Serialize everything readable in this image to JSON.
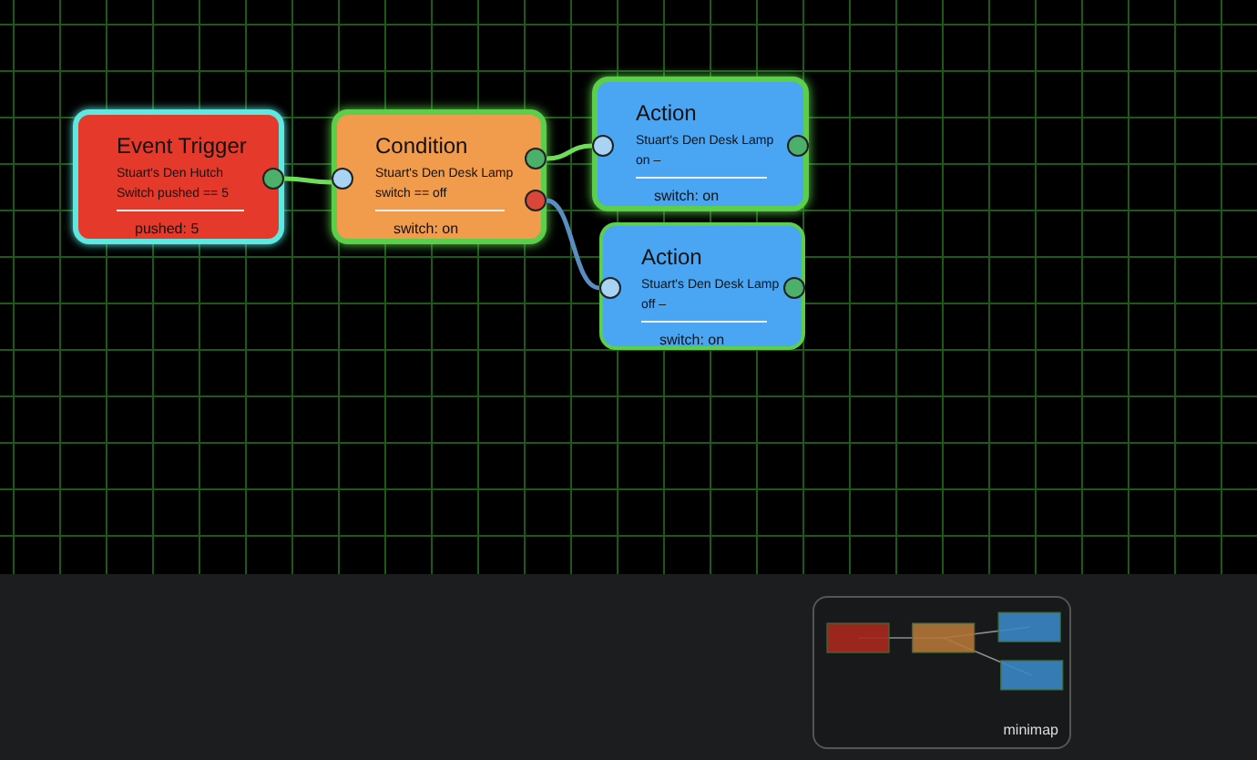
{
  "nodes": [
    {
      "kind": "trigger",
      "title": "Event Trigger",
      "lines": [
        "Stuart's Den Hutch",
        "Switch pushed == 5"
      ],
      "footer": "pushed: 5",
      "selected": true,
      "active": false,
      "ports": [
        {
          "kind": "output",
          "color": "#4caf6a"
        }
      ]
    },
    {
      "kind": "condition",
      "title": "Condition",
      "lines": [
        "Stuart's Den Desk Lamp",
        "switch == off"
      ],
      "footer": "switch: on",
      "selected": false,
      "active": true,
      "ports": [
        {
          "kind": "input",
          "color": "#a9d3f2"
        },
        {
          "kind": "output",
          "color": "#4caf6a"
        },
        {
          "kind": "output",
          "color": "#d9473a"
        }
      ]
    },
    {
      "kind": "action",
      "title": "Action",
      "lines": [
        "Stuart's Den Desk Lamp",
        "on –"
      ],
      "footer": "switch: on",
      "selected": false,
      "active": true,
      "ports": [
        {
          "kind": "input",
          "color": "#a9d3f2"
        },
        {
          "kind": "output",
          "color": "#4caf6a"
        }
      ]
    },
    {
      "kind": "action",
      "title": "Action",
      "lines": [
        "Stuart's Den Desk Lamp",
        "off –"
      ],
      "footer": "switch: on",
      "selected": false,
      "active": false,
      "ports": [
        {
          "kind": "input",
          "color": "#a9d3f2"
        },
        {
          "kind": "output",
          "color": "#4caf6a"
        }
      ]
    }
  ],
  "edges": [
    {
      "color": "#6fdc5a"
    },
    {
      "color": "#6fdc5a"
    },
    {
      "color": "#5a8ec0"
    }
  ],
  "minimap": {
    "label": "minimap"
  }
}
